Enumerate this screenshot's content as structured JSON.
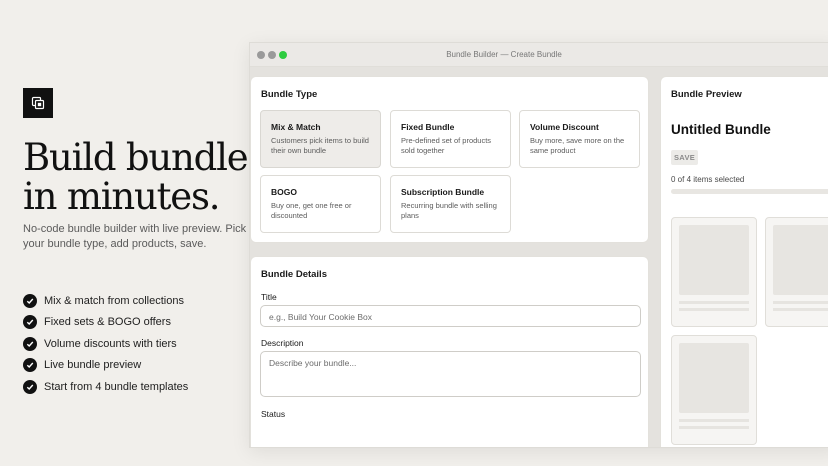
{
  "hero": {
    "headline_line1": "Build bundles",
    "headline_line2": "in minutes.",
    "subcopy": "No-code bundle builder with live preview. Pick your bundle type, add products, save.",
    "features": [
      "Mix & match from collections",
      "Fixed sets & BOGO offers",
      "Volume discounts with tiers",
      "Live bundle preview",
      "Start from 4 bundle templates"
    ]
  },
  "window": {
    "title": "Bundle Builder — Create Bundle"
  },
  "bundle_type": {
    "title": "Bundle Type",
    "options": [
      {
        "title": "Mix & Match",
        "desc": "Customers pick items to build their own bundle",
        "selected": true
      },
      {
        "title": "Fixed Bundle",
        "desc": "Pre-defined set of products sold together",
        "selected": false
      },
      {
        "title": "Volume Discount",
        "desc": "Buy more, save more on the same product",
        "selected": false
      },
      {
        "title": "BOGO",
        "desc": "Buy one, get one free or discounted",
        "selected": false
      },
      {
        "title": "Subscription Bundle",
        "desc": "Recurring bundle with selling plans",
        "selected": false
      }
    ]
  },
  "details": {
    "title": "Bundle Details",
    "title_label": "Title",
    "title_placeholder": "e.g., Build Your Cookie Box",
    "description_label": "Description",
    "description_placeholder": "Describe your bundle...",
    "status_label": "Status"
  },
  "preview": {
    "title": "Bundle Preview",
    "bundle_name": "Untitled Bundle",
    "save_badge": "SAVE",
    "count_text": "0 of 4 items selected",
    "progress": 0
  }
}
